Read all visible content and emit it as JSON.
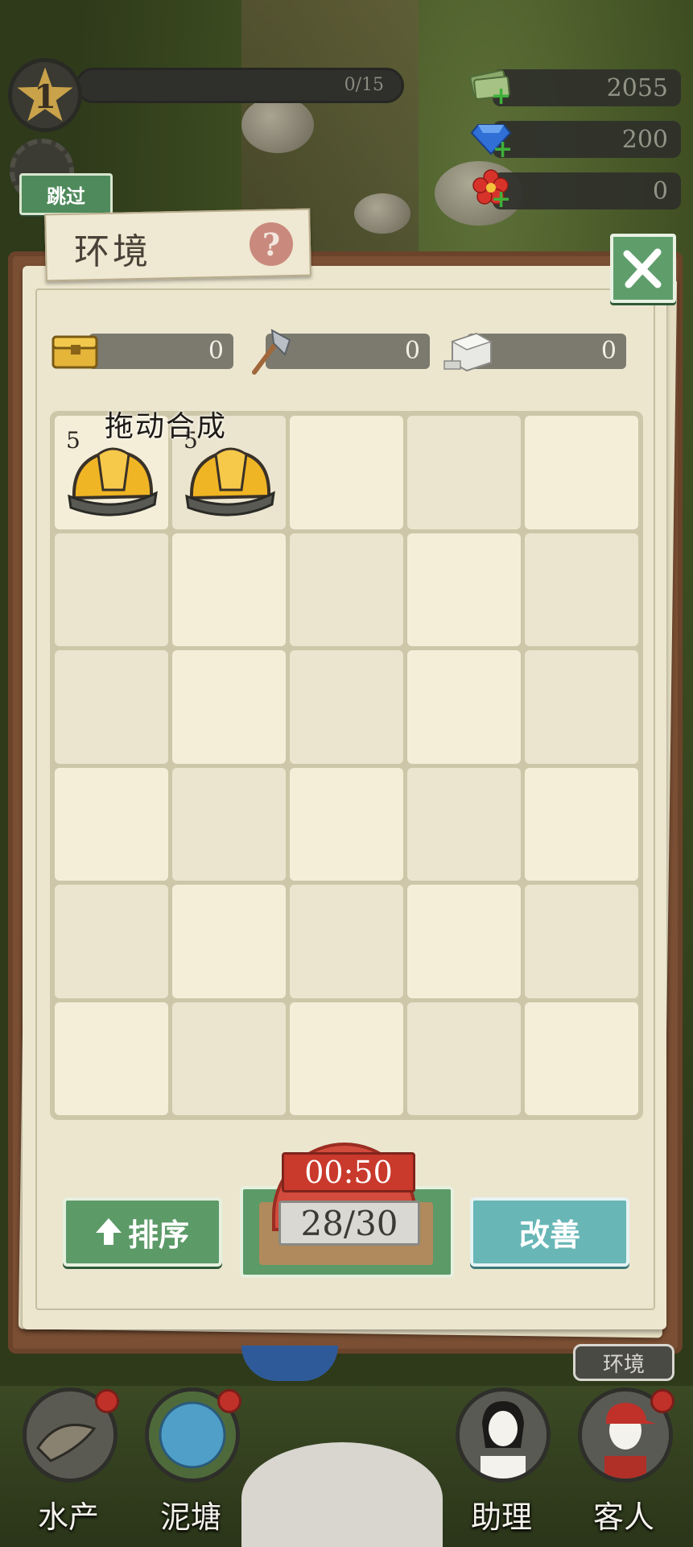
{
  "hud": {
    "level": "1",
    "xp": "0/15",
    "cash": "2055",
    "gems": "200",
    "flowers": "0",
    "skip_label": "跳过"
  },
  "panel": {
    "title": "环境",
    "help_label": "?",
    "resources": {
      "chest": "0",
      "axe": "0",
      "stone": "0"
    },
    "drag_hint": "拖动合成",
    "items": [
      {
        "name": "helmet",
        "level": "5"
      },
      {
        "name": "helmet",
        "level": "5"
      }
    ],
    "sort_label": "排序",
    "timer": "00:50",
    "capacity": "28/30",
    "improve_label": "改善"
  },
  "bottom_nav": {
    "items": [
      {
        "label": "水产",
        "badge": true
      },
      {
        "label": "泥塘",
        "badge": true
      },
      {
        "label": "助理",
        "badge": false
      },
      {
        "label": "客人",
        "badge": true
      }
    ],
    "env_chip": "环境"
  },
  "colors": {
    "green_button": "#5c9a68",
    "teal_button": "#68b6b6",
    "timer_red": "#c9392c",
    "badge_red": "#c0312a"
  }
}
